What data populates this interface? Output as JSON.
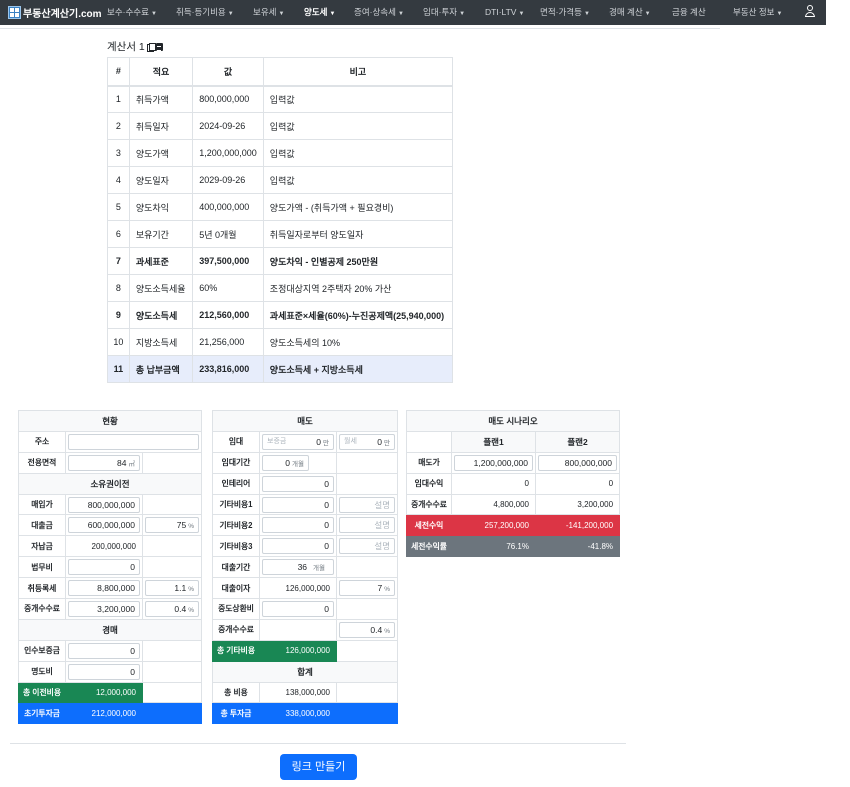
{
  "nav": {
    "brand": "부동산계산기.com",
    "items": [
      {
        "label": "보수·수수료",
        "active": false
      },
      {
        "label": "취득·등기비용",
        "active": false
      },
      {
        "label": "보유세",
        "active": false
      },
      {
        "label": "양도세",
        "active": true
      },
      {
        "label": "증여·상속세",
        "active": false
      },
      {
        "label": "임대·투자",
        "active": false
      },
      {
        "label": "DTI·LTV",
        "active": false
      },
      {
        "label": "면적·가격등",
        "active": false
      },
      {
        "label": "경매 계산",
        "active": false
      },
      {
        "label": "금융 계산",
        "active": false
      },
      {
        "label": "부동산 정보",
        "active": false
      }
    ]
  },
  "calc": {
    "title": "계산서 1",
    "headers": [
      "#",
      "적요",
      "값",
      "비고"
    ],
    "rows": [
      {
        "no": "1",
        "item": "취득가액",
        "value": "800,000,000",
        "note": "입력값",
        "bold": false
      },
      {
        "no": "2",
        "item": "취득일자",
        "value": "2024-09-26",
        "note": "입력값",
        "bold": false
      },
      {
        "no": "3",
        "item": "양도가액",
        "value": "1,200,000,000",
        "note": "입력값",
        "bold": false
      },
      {
        "no": "4",
        "item": "양도일자",
        "value": "2029-09-26",
        "note": "입력값",
        "bold": false
      },
      {
        "no": "5",
        "item": "양도차익",
        "value": "400,000,000",
        "note": "양도가액 - (취득가액 + 필요경비)",
        "bold": false
      },
      {
        "no": "6",
        "item": "보유기간",
        "value": "5년 0개월",
        "note": "취득일자로부터 양도일자",
        "bold": false
      },
      {
        "no": "7",
        "item": "과세표준",
        "value": "397,500,000",
        "note": "양도차익 - 인별공제 250만원",
        "bold": true
      },
      {
        "no": "8",
        "item": "양도소득세율",
        "value": "60%",
        "note": "조정대상지역 2주택자 20% 가산",
        "bold": false
      },
      {
        "no": "9",
        "item": "양도소득세",
        "value": "212,560,000",
        "note": "과세표준×세율(60%)-누진공제액(25,940,000)",
        "bold": true
      },
      {
        "no": "10",
        "item": "지방소득세",
        "value": "21,256,000",
        "note": "양도소득세의 10%",
        "bold": false
      },
      {
        "no": "11",
        "item": "총 납부금액",
        "value": "233,816,000",
        "note": "양도소득세 + 지방소득세",
        "bold": true
      }
    ]
  },
  "status": {
    "title": "현황",
    "address_label": "주소",
    "address_value": "",
    "area_label": "전용면적",
    "area_value": "84",
    "area_unit": "㎡",
    "transfer_title": "소유권이전",
    "purchase_label": "매입가",
    "purchase_value": "800,000,000",
    "loan_label": "대출금",
    "loan_value": "600,000,000",
    "loan_ratio": "75",
    "loan_ratio_unit": "%",
    "equity_label": "자납금",
    "equity_value": "200,000,000",
    "legal_label": "법무비",
    "legal_value": "0",
    "acq_tax_label": "취등록세",
    "acq_tax_value": "8,800,000",
    "acq_tax_rate": "1.1",
    "acq_tax_unit": "%",
    "broker_label": "중개수수료",
    "broker_value": "3,200,000",
    "broker_rate": "0.4",
    "broker_unit": "%",
    "auction_title": "경매",
    "deposit_label": "인수보증금",
    "deposit_value": "0",
    "eviction_label": "명도비",
    "eviction_value": "0",
    "transfer_total_label": "총 이전비용",
    "transfer_total_value": "12,000,000",
    "initial_label": "초기투자금",
    "initial_value": "212,000,000"
  },
  "sale": {
    "title": "매도",
    "rent_label": "임대",
    "rent_deposit_ph": "보증금",
    "rent_deposit_value": "0",
    "rent_deposit_unit": "만",
    "rent_monthly_ph": "월세",
    "rent_monthly_value": "0",
    "rent_monthly_unit": "만",
    "rent_period_label": "임대기간",
    "rent_period_value": "0",
    "rent_period_unit": "개월",
    "interior_label": "인테리어",
    "interior_value": "0",
    "other1_label": "기타비용1",
    "other1_value": "0",
    "other1_ph": "설명",
    "other2_label": "기타비용2",
    "other2_value": "0",
    "other2_ph": "설명",
    "other3_label": "기타비용3",
    "other3_value": "0",
    "other3_ph": "설명",
    "loan_period_label": "대출기간",
    "loan_period_value": "36",
    "loan_period_unit": "개월",
    "interest_label": "대출이자",
    "interest_value": "126,000,000",
    "interest_rate": "7",
    "interest_rate_unit": "%",
    "prepay_label": "중도상환비",
    "prepay_value": "0",
    "broker_label": "중개수수료",
    "broker_rate": "0.4",
    "broker_rate_unit": "%",
    "other_total_label": "총 기타비용",
    "other_total_value": "126,000,000",
    "sum_title": "합계",
    "total_cost_label": "총 비용",
    "total_cost_value": "138,000,000",
    "total_invest_label": "총 투자금",
    "total_invest_value": "338,000,000"
  },
  "scenario": {
    "title": "매도 시나리오",
    "plans": [
      "플랜1",
      "플랜2"
    ],
    "rows": [
      {
        "label": "매도가",
        "values": [
          "1,200,000,000",
          "800,000,000"
        ]
      },
      {
        "label": "임대수익",
        "values": [
          "0",
          "0"
        ]
      },
      {
        "label": "중개수수료",
        "values": [
          "4,800,000",
          "3,200,000"
        ]
      },
      {
        "label": "세전수익",
        "values": [
          "257,200,000",
          "-141,200,000"
        ]
      },
      {
        "label": "세전수익률",
        "values": [
          "76.1%",
          "-41.8%"
        ]
      }
    ]
  },
  "footer": {
    "button": "링크 만들기"
  },
  "colors": {
    "navbar": "#343a40",
    "green": "#198754",
    "blue": "#0d6efd",
    "red": "#dc3545",
    "grey": "#6c757d",
    "highlight": "#e7edfb"
  }
}
